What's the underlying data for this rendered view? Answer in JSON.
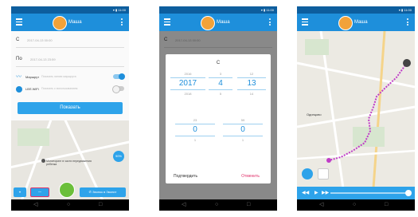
{
  "colors": {
    "accent": "#1e8fdb",
    "button": "#2ea3ea",
    "green": "#6bbf3a",
    "route": "#c03cc8",
    "highlight": "#e0306a"
  },
  "screen1": {
    "user_name": "Маша",
    "from_label": "С",
    "from_value": "2017-04-13 00:00",
    "to_label": "По",
    "to_value": "2017-04-13 23:59",
    "route_label": "Маршрут",
    "route_desc": "Показать линию маршрута",
    "lbs_label": "LBS WiFi",
    "lbs_desc": "Показать с использованием",
    "show_button": "Показать",
    "map_text": "Мониторинг в части передвижения ребенка",
    "battery_text": "90%",
    "call_button": "Звонок в Звонит"
  },
  "screen2": {
    "user_name": "Маша",
    "from_label": "С",
    "from_value": "2017-04-13 00:00",
    "dialog_title": "С",
    "date_picker": {
      "years": [
        "2016",
        "2017",
        "2018"
      ],
      "months": [
        "3",
        "4",
        "5"
      ],
      "days": [
        "12",
        "13",
        "14"
      ]
    },
    "time_picker": {
      "hours": [
        "23",
        "0",
        "1"
      ],
      "minutes": [
        "59",
        "0",
        "1"
      ]
    },
    "confirm_button": "Подтвердить",
    "cancel_button": "Отменить"
  },
  "screen3": {
    "user_name": "Маша",
    "place_label": "Одинцово"
  },
  "icons": [
    "menu-icon",
    "more-icon",
    "route-icon",
    "wifi-icon",
    "location-icon",
    "history-icon",
    "chat-icon",
    "phone-icon",
    "play-icon",
    "rewind-icon",
    "forward-icon"
  ]
}
